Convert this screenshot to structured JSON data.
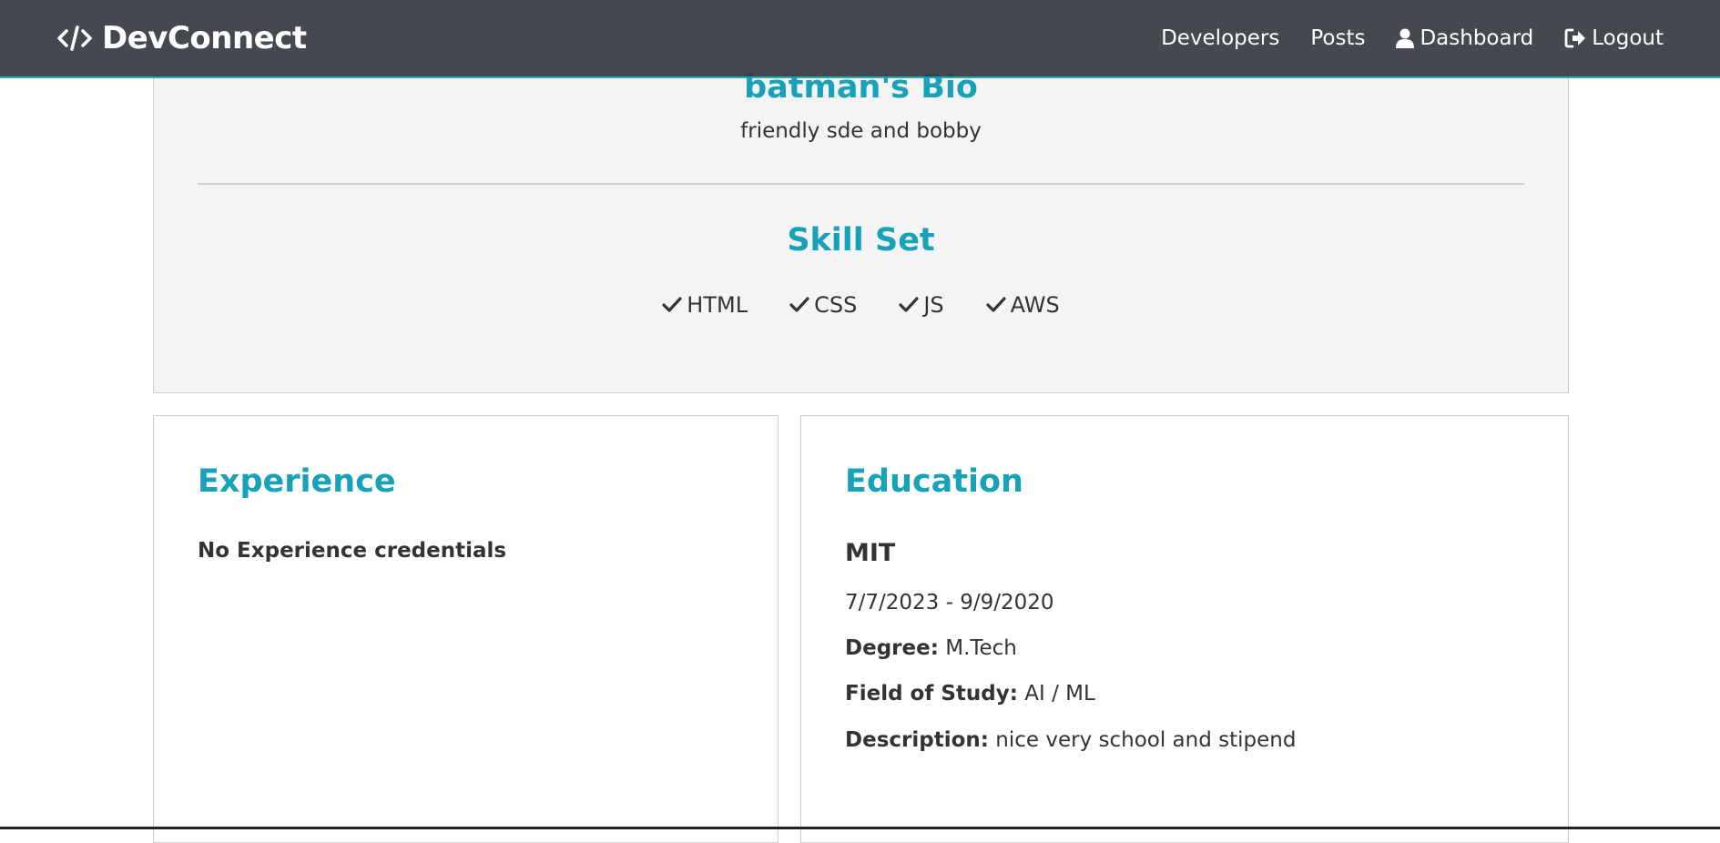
{
  "navbar": {
    "brand": "DevConnect",
    "links": [
      {
        "label": "Developers",
        "icon": ""
      },
      {
        "label": "Posts",
        "icon": ""
      },
      {
        "label": "Dashboard",
        "icon": "user-icon"
      },
      {
        "label": "Logout",
        "icon": "sign-out-icon"
      }
    ]
  },
  "bio": {
    "title": "batman's Bio",
    "text": "friendly sde and bobby"
  },
  "skills": {
    "title": "Skill Set",
    "items": [
      "HTML",
      "CSS",
      "JS",
      "AWS"
    ]
  },
  "experience": {
    "title": "Experience",
    "empty_message": "No Experience credentials"
  },
  "education": {
    "title": "Education",
    "school": "MIT",
    "dates": "7/7/2023 - 9/9/2020",
    "degree_label": "Degree:",
    "degree": "M.Tech",
    "field_label": "Field of Study:",
    "field": "AI / ML",
    "description_label": "Description:",
    "description": "nice very school and stipend"
  },
  "colors": {
    "navbar": "#343a40",
    "primary": "#17a2b8",
    "light_bg": "#f4f4f4"
  }
}
